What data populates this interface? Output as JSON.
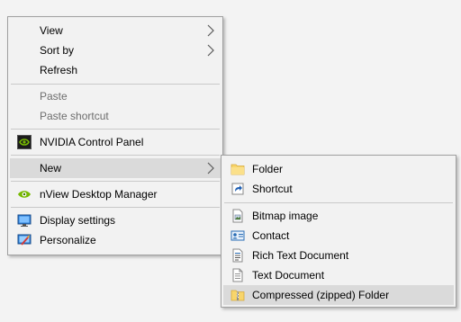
{
  "context_menu": {
    "items": [
      {
        "label": "View"
      },
      {
        "label": "Sort by"
      },
      {
        "label": "Refresh"
      },
      {
        "label": "Paste"
      },
      {
        "label": "Paste shortcut"
      },
      {
        "label": "NVIDIA Control Panel",
        "icon": "nvidia-icon"
      },
      {
        "label": "New"
      },
      {
        "label": "nView Desktop Manager",
        "icon": "nview-icon"
      },
      {
        "label": "Display settings",
        "icon": "display-icon"
      },
      {
        "label": "Personalize",
        "icon": "personalize-icon"
      }
    ]
  },
  "new_submenu": {
    "items": [
      {
        "label": "Folder",
        "icon": "folder-icon"
      },
      {
        "label": "Shortcut",
        "icon": "shortcut-icon"
      },
      {
        "label": "Bitmap image",
        "icon": "bitmap-icon"
      },
      {
        "label": "Contact",
        "icon": "contact-icon"
      },
      {
        "label": "Rich Text Document",
        "icon": "rich-text-document-icon"
      },
      {
        "label": "Text Document",
        "icon": "text-document-icon"
      },
      {
        "label": "Compressed (zipped) Folder",
        "icon": "zip-folder-icon"
      }
    ]
  },
  "colors": {
    "menu_bg": "#f2f2f2",
    "highlight": "#dadada",
    "disabled_text": "#6d6d6d",
    "separator": "#c9c9c9",
    "nvidia_green": "#76b900",
    "folder_yellow": "#f8d56b"
  }
}
